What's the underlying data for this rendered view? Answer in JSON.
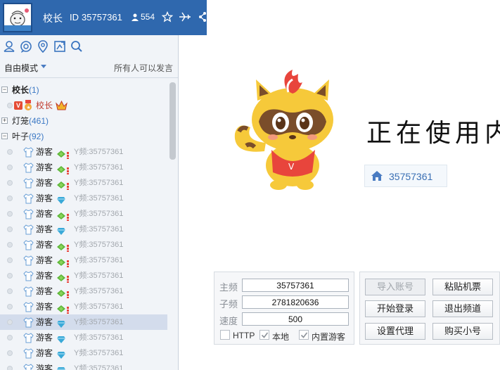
{
  "header": {
    "room_name": "校长",
    "id_label": "ID",
    "room_id": "35757361",
    "online_count": "554"
  },
  "toolbar": {
    "icons": [
      "user-icon",
      "chat-bubble-icon",
      "location-pin-icon",
      "screen-share-icon",
      "search-icon"
    ]
  },
  "mode": {
    "selected": "自由模式",
    "speak_permission": "所有人可以发言"
  },
  "tree": {
    "groups": [
      {
        "name": "校长",
        "count": "(1)"
      },
      {
        "name": "灯笼",
        "count": "(461)"
      },
      {
        "name": "叶子",
        "count": "(92)"
      }
    ],
    "host": {
      "vip_badge": "V",
      "name": "校长"
    },
    "guests": [
      {
        "name": "游客",
        "badge": "leaf",
        "y_id": "Y频:35757361"
      },
      {
        "name": "游客",
        "badge": "leaf",
        "y_id": "Y频:35757361"
      },
      {
        "name": "游客",
        "badge": "leaf",
        "y_id": "Y频:35757361"
      },
      {
        "name": "游客",
        "badge": "diamond",
        "y_id": "Y频:35757361"
      },
      {
        "name": "游客",
        "badge": "leaf",
        "y_id": "Y频:35757361"
      },
      {
        "name": "游客",
        "badge": "diamond",
        "y_id": "Y频:35757361"
      },
      {
        "name": "游客",
        "badge": "leaf",
        "y_id": "Y频:35757361"
      },
      {
        "name": "游客",
        "badge": "leaf",
        "y_id": "Y频:35757361"
      },
      {
        "name": "游客",
        "badge": "leaf",
        "y_id": "Y频:35757361"
      },
      {
        "name": "游客",
        "badge": "leaf",
        "y_id": "Y频:35757361"
      },
      {
        "name": "游客",
        "badge": "leaf",
        "y_id": "Y频:35757361"
      },
      {
        "name": "游客",
        "badge": "diamond",
        "y_id": "Y频:35757361"
      },
      {
        "name": "游客",
        "badge": "diamond",
        "y_id": "Y频:35757361"
      },
      {
        "name": "游客",
        "badge": "diamond",
        "y_id": "Y频:35757361"
      },
      {
        "name": "游客",
        "badge": "diamond",
        "y_id": "Y频:35757361"
      }
    ],
    "selected_index": 11
  },
  "stage": {
    "using_text": "正在使用内",
    "room_id": "35757361"
  },
  "login": {
    "main_label": "主频",
    "main_value": "35757361",
    "sub_label": "子频",
    "sub_value": "2781820636",
    "speed_label": "速度",
    "speed_value": "500",
    "http_label": "HTTP",
    "local_label": "本地",
    "builtin_guest_label": "内置游客",
    "http_checked": false,
    "local_checked": true,
    "builtin_guest_checked": true
  },
  "actions": {
    "import_account": "导入账号",
    "paste_ticket": "粘贴机票",
    "start_login": "开始登录",
    "exit_channel": "退出频道",
    "set_proxy": "设置代理",
    "buy_account": "购买小号"
  },
  "colors": {
    "header_bg": "#2f68ae",
    "accent_blue": "#3b78c4",
    "host_red": "#c0392b"
  }
}
